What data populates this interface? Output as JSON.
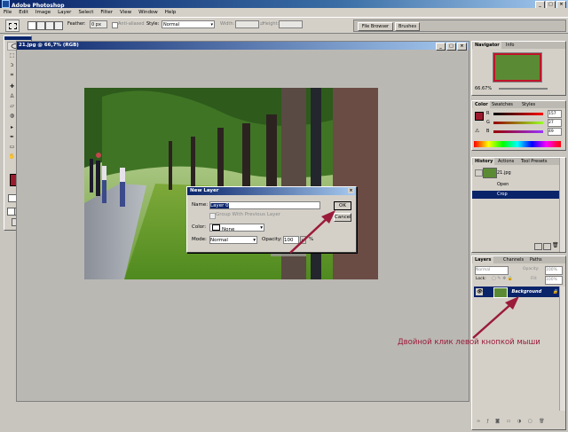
{
  "app": {
    "title": "Adobe Photoshop"
  },
  "menu": [
    "File",
    "Edit",
    "Image",
    "Layer",
    "Select",
    "Filter",
    "View",
    "Window",
    "Help"
  ],
  "options": {
    "feather_label": "Feather:",
    "feather_value": "0 px",
    "antialiased_label": "Anti-aliased",
    "style_label": "Style:",
    "style_value": "Normal",
    "width_label": "Width:",
    "height_label": "Height:"
  },
  "palette_well": {
    "tabs": [
      "File Browser",
      "Brushes"
    ]
  },
  "document": {
    "title": "21.jpg @ 66,7% (RGB)"
  },
  "dialog": {
    "title": "New Layer",
    "name_label": "Name:",
    "name_value": "Layer 0",
    "group_label": "Group With Previous Layer",
    "color_label": "Color:",
    "color_value": "None",
    "mode_label": "Mode:",
    "mode_value": "Normal",
    "opacity_label": "Opacity:",
    "opacity_value": "100",
    "opacity_unit": "%",
    "ok_label": "OK",
    "cancel_label": "Cancel"
  },
  "navigator": {
    "tabs": [
      "Navigator",
      "Info"
    ],
    "zoom": "66.67%"
  },
  "color_panel": {
    "tabs": [
      "Color",
      "Swatches",
      "Styles"
    ],
    "r": "157",
    "g": "27",
    "b": "49",
    "fg": "#9b1b2e"
  },
  "history": {
    "tabs": [
      "History",
      "Actions",
      "Tool Presets"
    ],
    "snapshot": "21.jpg",
    "items": [
      "Open",
      "Crop"
    ]
  },
  "layers": {
    "tabs": [
      "Layers",
      "Channels",
      "Paths"
    ],
    "blend": "Normal",
    "opacity_label": "Opacity:",
    "opacity": "100%",
    "lock_label": "Lock:",
    "fill_label": "Fill:",
    "fill": "100%",
    "layer_name": "Background"
  },
  "annotation": "Двойной клик левой кнопкой мыши"
}
